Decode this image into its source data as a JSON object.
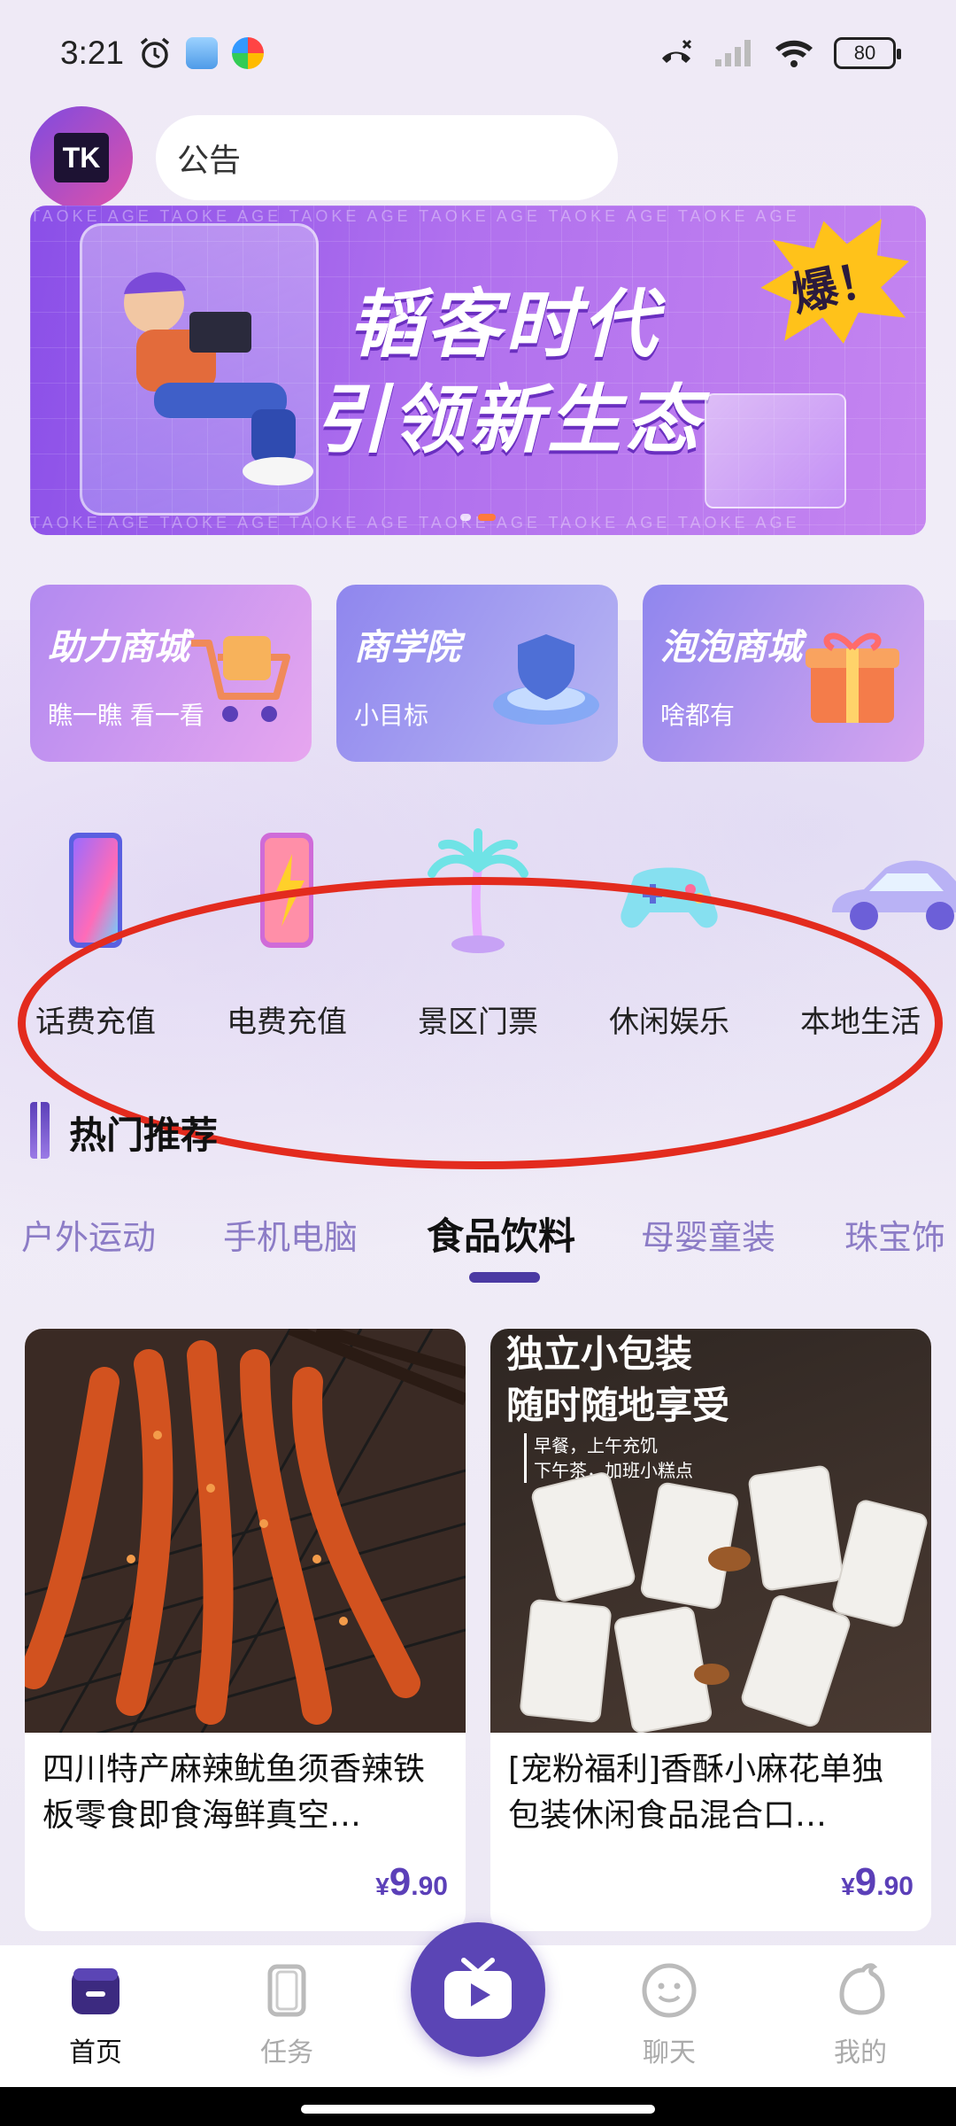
{
  "status_bar": {
    "time": "3:21",
    "battery": "80"
  },
  "header": {
    "logo_text": "TK",
    "notice_label": "公告"
  },
  "banner": {
    "title_line1": "韬客时代",
    "title_line2": "引领新生态",
    "burst_text": "爆！",
    "watermark": "TAOKE AGE  TAOKE AGE  TAOKE AGE  TAOKE AGE  TAOKE AGE  TAOKE AGE"
  },
  "features": [
    {
      "title": "助力商城",
      "subtitle": "瞧一瞧 看一看"
    },
    {
      "title": "商学院",
      "subtitle": "小目标"
    },
    {
      "title": "泡泡商城",
      "subtitle": "啥都有"
    }
  ],
  "categories": [
    {
      "label": "话费充值",
      "icon": "phone-icon"
    },
    {
      "label": "电费充值",
      "icon": "phone-lightning-icon"
    },
    {
      "label": "景区门票",
      "icon": "palm-tree-icon"
    },
    {
      "label": "休闲娱乐",
      "icon": "gamepad-icon"
    },
    {
      "label": "本地生活",
      "icon": "car-icon"
    }
  ],
  "hot": {
    "title": "热门推荐",
    "tabs": [
      "户外运动",
      "手机电脑",
      "食品饮料",
      "母婴童装",
      "珠宝饰"
    ],
    "active_tab": "食品饮料"
  },
  "products": [
    {
      "name": "四川特产麻辣鱿鱼须香辣铁板零食即食海鲜真空…",
      "currency": "¥",
      "price_int": "9",
      "price_dec": ".90"
    },
    {
      "name": "[宠粉福利]香酥小麻花单独包装休闲食品混合口…",
      "currency": "¥",
      "price_int": "9",
      "price_dec": ".90",
      "image_text_1": "独立小包装",
      "image_text_2": "随时随地享受",
      "image_text_3": "早餐，上午充饥",
      "image_text_4": "下午茶，加班小糕点"
    }
  ],
  "nav": {
    "items": [
      "首页",
      "任务",
      "聊天",
      "我的"
    ],
    "active": "首页"
  },
  "colors": {
    "accent": "#5b45b5",
    "annotation": "#e32b1e"
  }
}
